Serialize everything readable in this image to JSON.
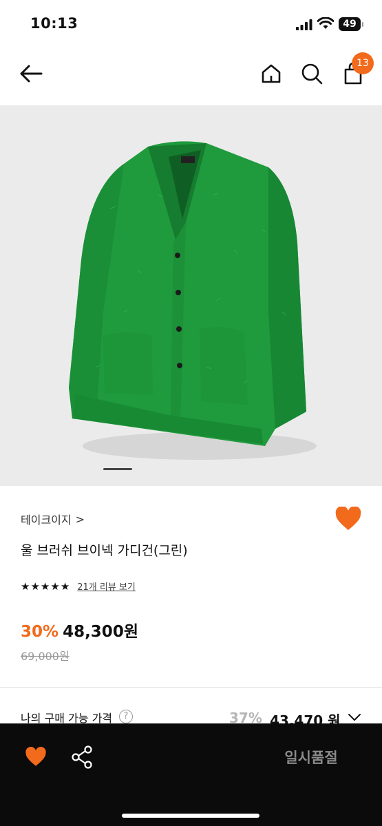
{
  "status_bar": {
    "time": "10:13",
    "battery": "49",
    "icons": [
      "signal-icon",
      "wifi-icon",
      "battery-icon"
    ]
  },
  "header": {
    "cart_count": "13",
    "icons": [
      "back-arrow-icon",
      "home-icon",
      "search-icon",
      "cart-icon"
    ]
  },
  "product": {
    "image": "green-cardigan-photo",
    "brand": "테이크이지",
    "brand_chevron": ">",
    "title": "울 브러쉬 브이넥 가디건(그린)",
    "rating_stars": 5,
    "review_link": "21개 리뷰 보기",
    "discount": "30%",
    "price": "48,300원",
    "original_price": "69,000원",
    "wishlisted": true
  },
  "my_price": {
    "label": "나의 구매 가능 가격",
    "help": "?",
    "discount": "37%",
    "price": "43,470 원"
  },
  "bottom_bar": {
    "soldout_label": "일시품절",
    "icons": [
      "heart-icon",
      "share-icon"
    ]
  },
  "colors": {
    "accent": "#f26a1b",
    "product_green": "#1f9a3c",
    "bottom_bar": "#0b0b0b"
  }
}
